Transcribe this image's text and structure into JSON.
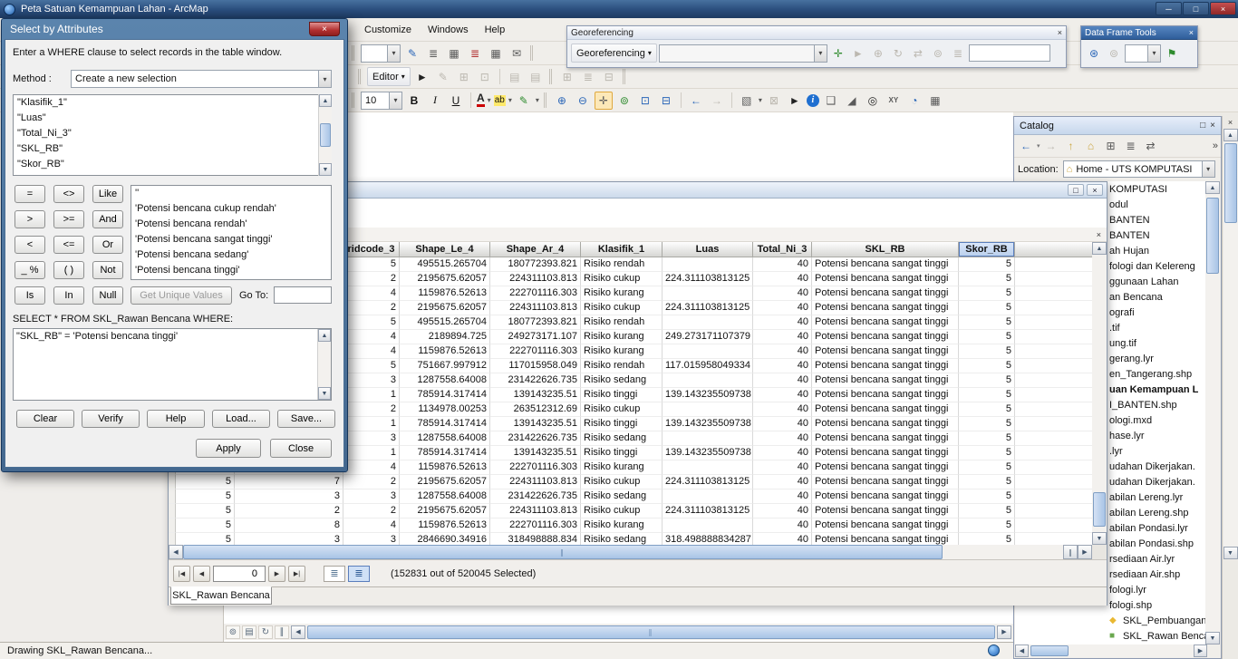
{
  "window": {
    "title": "Peta Satuan Kemampuan Lahan - ArcMap",
    "status": "Drawing SKL_Rawan Bencana..."
  },
  "menus": [
    "Customize",
    "Windows",
    "Help"
  ],
  "georef": {
    "title": "Georeferencing",
    "menu_label": "Georeferencing"
  },
  "dft": {
    "title": "Data Frame Tools"
  },
  "editor": {
    "label": "Editor"
  },
  "font": {
    "size": "10",
    "bold": "B",
    "italic": "I",
    "underline": "U",
    "color_label": "A",
    "highlight_label": "ab"
  },
  "dialog": {
    "title": "Select by Attributes",
    "instruction": "Enter a WHERE clause to select records in the table window.",
    "method_label": "Method :",
    "method_value": "Create a new selection",
    "fields": [
      "\"Klasifik_1\"",
      "\"Luas\"",
      "\"Total_Ni_3\"",
      "\"SKL_RB\"",
      "\"Skor_RB\""
    ],
    "operators": [
      "=",
      "<>",
      "Like",
      ">",
      ">=",
      "And",
      "<",
      "<=",
      "Or",
      "_ %",
      "( )",
      "Not",
      "Is",
      "In",
      "Null"
    ],
    "values": [
      "''",
      "'Potensi bencana cukup rendah'",
      "'Potensi bencana rendah'",
      "'Potensi bencana sangat tinggi'",
      "'Potensi bencana sedang'",
      "'Potensi bencana tinggi'"
    ],
    "get_unique_values": "Get Unique Values",
    "goto_label": "Go To:",
    "goto_value": "",
    "select_from": "SELECT * FROM SKL_Rawan Bencana WHERE:",
    "where_clause": "\"SKL_RB\" = 'Potensi bencana tinggi'",
    "btn_clear": "Clear",
    "btn_verify": "Verify",
    "btn_help": "Help",
    "btn_load": "Load...",
    "btn_save": "Save...",
    "btn_apply": "Apply",
    "btn_close": "Close"
  },
  "table": {
    "columns": [
      "",
      "",
      "ridcode_3",
      "Shape_Le_4",
      "Shape_Ar_4",
      "Klasifik_1",
      "Luas",
      "Total_Ni_3",
      "SKL_RB",
      "Skor_RB"
    ],
    "rows": [
      [
        "",
        "",
        "5",
        "495515.265704",
        "180772393.821",
        "Risiko rendah",
        "",
        "40",
        "Potensi bencana sangat tinggi",
        "5"
      ],
      [
        "",
        "",
        "2",
        "2195675.62057",
        "224311103.813",
        "Risiko cukup",
        "224.311103813125",
        "40",
        "Potensi bencana sangat tinggi",
        "5"
      ],
      [
        "",
        "",
        "4",
        "1159876.52613",
        "222701116.303",
        "Risiko kurang",
        "",
        "40",
        "Potensi bencana sangat tinggi",
        "5"
      ],
      [
        "",
        "",
        "2",
        "2195675.62057",
        "224311103.813",
        "Risiko cukup",
        "224.311103813125",
        "40",
        "Potensi bencana sangat tinggi",
        "5"
      ],
      [
        "",
        "",
        "5",
        "495515.265704",
        "180772393.821",
        "Risiko rendah",
        "",
        "40",
        "Potensi bencana sangat tinggi",
        "5"
      ],
      [
        "",
        "",
        "4",
        "2189894.725",
        "249273171.107",
        "Risiko kurang",
        "249.273171107379",
        "40",
        "Potensi bencana sangat tinggi",
        "5"
      ],
      [
        "",
        "",
        "4",
        "1159876.52613",
        "222701116.303",
        "Risiko kurang",
        "",
        "40",
        "Potensi bencana sangat tinggi",
        "5"
      ],
      [
        "",
        "",
        "5",
        "751667.997912",
        "117015958.049",
        "Risiko rendah",
        "117.015958049334",
        "40",
        "Potensi bencana sangat tinggi",
        "5"
      ],
      [
        "",
        "",
        "3",
        "1287558.64008",
        "231422626.735",
        "Risiko sedang",
        "",
        "40",
        "Potensi bencana sangat tinggi",
        "5"
      ],
      [
        "",
        "",
        "1",
        "785914.317414",
        "139143235.51",
        "Risiko tinggi",
        "139.143235509738",
        "40",
        "Potensi bencana sangat tinggi",
        "5"
      ],
      [
        "",
        "",
        "2",
        "1134978.00253",
        "263512312.69",
        "Risiko cukup",
        "",
        "40",
        "Potensi bencana sangat tinggi",
        "5"
      ],
      [
        "",
        "",
        "1",
        "785914.317414",
        "139143235.51",
        "Risiko tinggi",
        "139.143235509738",
        "40",
        "Potensi bencana sangat tinggi",
        "5"
      ],
      [
        "",
        "",
        "3",
        "1287558.64008",
        "231422626.735",
        "Risiko sedang",
        "",
        "40",
        "Potensi bencana sangat tinggi",
        "5"
      ],
      [
        "",
        "",
        "1",
        "785914.317414",
        "139143235.51",
        "Risiko tinggi",
        "139.143235509738",
        "40",
        "Potensi bencana sangat tinggi",
        "5"
      ],
      [
        "5",
        "1",
        "4",
        "1159876.52613",
        "222701116.303",
        "Risiko kurang",
        "",
        "40",
        "Potensi bencana sangat tinggi",
        "5"
      ],
      [
        "5",
        "7",
        "2",
        "2195675.62057",
        "224311103.813",
        "Risiko cukup",
        "224.311103813125",
        "40",
        "Potensi bencana sangat tinggi",
        "5"
      ],
      [
        "5",
        "3",
        "3",
        "1287558.64008",
        "231422626.735",
        "Risiko sedang",
        "",
        "40",
        "Potensi bencana sangat tinggi",
        "5"
      ],
      [
        "5",
        "2",
        "2",
        "2195675.62057",
        "224311103.813",
        "Risiko cukup",
        "224.311103813125",
        "40",
        "Potensi bencana sangat tinggi",
        "5"
      ],
      [
        "5",
        "8",
        "4",
        "1159876.52613",
        "222701116.303",
        "Risiko kurang",
        "",
        "40",
        "Potensi bencana sangat tinggi",
        "5"
      ],
      [
        "5",
        "3",
        "3",
        "2846690.34916",
        "318498888.834",
        "Risiko sedang",
        "318.498888834287",
        "40",
        "Potensi bencana sangat tinggi",
        "5"
      ]
    ],
    "nav_value": "0",
    "selection_status": "(152831 out of 520045 Selected)",
    "tab": "SKL_Rawan Bencana"
  },
  "catalog": {
    "title": "Catalog",
    "location_label": "Location:",
    "location_value": "Home - UTS KOMPUTASI",
    "tree": [
      {
        "label": "KOMPUTASI"
      },
      {
        "label": "odul"
      },
      {
        "label": "BANTEN"
      },
      {
        "label": "BANTEN"
      },
      {
        "label": "ah Hujan"
      },
      {
        "label": "fologi dan Kelereng"
      },
      {
        "label": "ggunaan Lahan"
      },
      {
        "label": "an Bencana"
      },
      {
        "label": "ografi"
      },
      {
        "label": ".tif"
      },
      {
        "label": "ung.tif"
      },
      {
        "label": "gerang.lyr"
      },
      {
        "label": "en_Tangerang.shp"
      },
      {
        "label": "uan Kemampuan L",
        "bold": true
      },
      {
        "label": "I_BANTEN.shp"
      },
      {
        "label": "ologi.mxd"
      },
      {
        "label": "hase.lyr"
      },
      {
        "label": ".lyr"
      },
      {
        "label": "udahan Dikerjakan."
      },
      {
        "label": "udahan Dikerjakan."
      },
      {
        "label": "abilan Lereng.lyr"
      },
      {
        "label": "abilan Lereng.shp"
      },
      {
        "label": "abilan Pondasi.lyr"
      },
      {
        "label": "abilan Pondasi.shp"
      },
      {
        "label": "rsediaan Air.lyr"
      },
      {
        "label": "rsediaan Air.shp"
      },
      {
        "label": "fologi.lyr"
      },
      {
        "label": "fologi.shp"
      },
      {
        "label": "SKL_Pembuangan Limbah.ly",
        "icon": "lyr",
        "glyph": "◆"
      },
      {
        "label": "SKL_Rawan Bencana.sho",
        "icon": "shp",
        "glyph": "■"
      }
    ]
  },
  "icons": {
    "minimize": "─",
    "restore": "□",
    "close": "×",
    "dropdown": "▾",
    "overflow": "»",
    "left": "◀",
    "right": "▶",
    "up": "▲",
    "down": "▼",
    "back": "←",
    "forward": "→",
    "uplevel": "↑",
    "home": "⌂",
    "connect": "⊞",
    "treeview": "≣",
    "swap": "⇄",
    "panel": "▤",
    "pencil": "✎",
    "table": "≣",
    "mail": "✉",
    "pointer": "►",
    "zoomin": "⊕",
    "zoomout": "⊖",
    "pan": "✛",
    "fullext": "⊚",
    "fixedin": "⊡",
    "fixedout": "⊟",
    "selfeat": "▧",
    "clearsel": "⊠",
    "popup": "❑",
    "measure": "◢",
    "find": "◎",
    "xy": "XY",
    "clock": "◔",
    "viewer": "▦",
    "first": "|◀",
    "prev": "◀",
    "next": "▶",
    "last": "▶|",
    "refresh": "↻",
    "pause": "∥",
    "crosshair": "✛",
    "rotate": "↻",
    "flag": "⚑",
    "globe": "⊛",
    "grid": "▦",
    "info": "i"
  }
}
